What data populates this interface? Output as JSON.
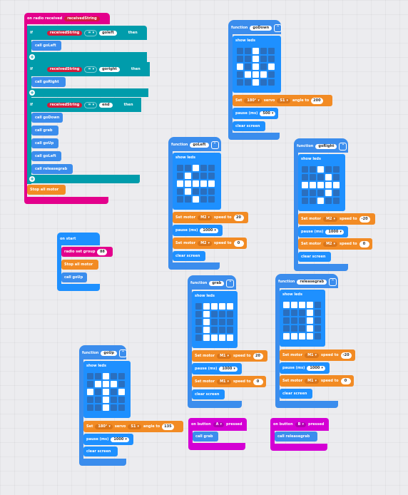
{
  "colors": {
    "radio": "#e3008c",
    "logic": "#009cab",
    "func": "#3b8ded",
    "funcDark": "#1f5fae",
    "basic": "#1e90ff",
    "motor": "#f28b24",
    "input": "#d400d4",
    "receivedPill": "#d31b3a"
  },
  "radio_handler": {
    "header": "on radio received",
    "param": "receivedString",
    "if_label": "if",
    "cond_var": "receivedString",
    "op": "=",
    "then_label": "then",
    "branches": [
      {
        "value": "goleft",
        "calls": [
          "call goLeft"
        ]
      },
      {
        "value": "goright",
        "calls": [
          "call goRight"
        ]
      },
      {
        "value": "end",
        "calls": [
          "call goDown",
          "call grab",
          "call goUp",
          "call goLeft",
          "call releasegrab"
        ]
      }
    ],
    "stop": "Stop all motor"
  },
  "on_start": {
    "header": "on start",
    "set_group": "radio set group",
    "group_value": "88",
    "stop": "Stop all motor",
    "call": "call goUp"
  },
  "func_goDown": {
    "header": "function",
    "name": "goDown",
    "show": "show leds",
    "leds": [
      [
        0,
        0,
        1,
        0,
        0
      ],
      [
        0,
        0,
        1,
        0,
        0
      ],
      [
        1,
        0,
        1,
        0,
        1
      ],
      [
        0,
        1,
        1,
        1,
        0
      ],
      [
        0,
        0,
        1,
        0,
        0
      ]
    ],
    "set": "Set",
    "angle_dd": "180°",
    "servo": "servo",
    "servo_dd": "S1",
    "angle_to": "angle to",
    "angle": "200",
    "pause": "pause (ms)",
    "pause_val": "500",
    "clear": "clear screen"
  },
  "func_goLeft": {
    "header": "function",
    "name": "goLeft",
    "show": "show leds",
    "leds": [
      [
        0,
        0,
        1,
        0,
        0
      ],
      [
        0,
        1,
        0,
        0,
        0
      ],
      [
        1,
        1,
        1,
        1,
        1
      ],
      [
        0,
        1,
        0,
        0,
        0
      ],
      [
        0,
        0,
        1,
        0,
        0
      ]
    ],
    "m1": "Set motor",
    "m1_dd": "M2",
    "speed_to": "speed to",
    "m1_val": "20",
    "pause": "pause (ms)",
    "pause_val": "1000",
    "m2": "Set motor",
    "m2_dd": "M2",
    "m2_val": "0",
    "clear": "clear screen"
  },
  "func_goRight": {
    "header": "function",
    "name": "goRight",
    "show": "show leds",
    "leds": [
      [
        0,
        0,
        1,
        0,
        0
      ],
      [
        0,
        0,
        0,
        1,
        0
      ],
      [
        1,
        1,
        1,
        1,
        1
      ],
      [
        0,
        0,
        0,
        1,
        0
      ],
      [
        0,
        0,
        1,
        0,
        0
      ]
    ],
    "m1": "Set motor",
    "m1_dd": "M2",
    "speed_to": "speed to",
    "m1_val": "-20",
    "pause": "pause (ms)",
    "pause_val": "1000",
    "m2": "Set motor",
    "m2_dd": "M2",
    "m2_val": "0",
    "clear": "clear screen"
  },
  "func_grab": {
    "header": "function",
    "name": "grab",
    "show": "show leds",
    "leds": [
      [
        0,
        1,
        1,
        1,
        1
      ],
      [
        0,
        1,
        0,
        0,
        0
      ],
      [
        0,
        1,
        0,
        0,
        0
      ],
      [
        0,
        1,
        0,
        0,
        0
      ],
      [
        0,
        1,
        1,
        1,
        1
      ]
    ],
    "m1": "Set motor",
    "m1_dd": "M1",
    "speed_to": "speed to",
    "m1_val": "20",
    "pause": "pause (ms)",
    "pause_val": "1000",
    "m2": "Set motor",
    "m2_dd": "M1",
    "m2_val": "0",
    "clear": "clear screen"
  },
  "func_releasegrab": {
    "header": "function",
    "name": "releasegrab",
    "show": "show leds",
    "leds": [
      [
        1,
        1,
        1,
        1,
        0
      ],
      [
        0,
        0,
        0,
        1,
        0
      ],
      [
        0,
        0,
        0,
        1,
        0
      ],
      [
        0,
        0,
        0,
        1,
        0
      ],
      [
        1,
        1,
        1,
        1,
        0
      ]
    ],
    "m1": "Set motor",
    "m1_dd": "M1",
    "speed_to": "speed to",
    "m1_val": "-20",
    "pause": "pause (ms)",
    "pause_val": "1000",
    "m2": "Set motor",
    "m2_dd": "M1",
    "m2_val": "0",
    "clear": "clear screen"
  },
  "func_goUp": {
    "header": "function",
    "name": "goUp",
    "show": "show leds",
    "leds": [
      [
        0,
        0,
        1,
        0,
        0
      ],
      [
        0,
        1,
        1,
        1,
        0
      ],
      [
        1,
        0,
        1,
        0,
        1
      ],
      [
        0,
        0,
        1,
        0,
        0
      ],
      [
        0,
        0,
        1,
        0,
        0
      ]
    ],
    "set": "Set",
    "angle_dd": "180°",
    "servo": "servo",
    "servo_dd": "S1",
    "angle_to": "angle to",
    "angle": "135",
    "pause": "pause (ms)",
    "pause_val": "1000",
    "clear": "clear screen"
  },
  "button_a": {
    "on": "on button",
    "btn": "A",
    "pressed": "pressed",
    "call": "call grab"
  },
  "button_b": {
    "on": "on button",
    "btn": "B",
    "pressed": "pressed",
    "call": "call releasegrab"
  }
}
